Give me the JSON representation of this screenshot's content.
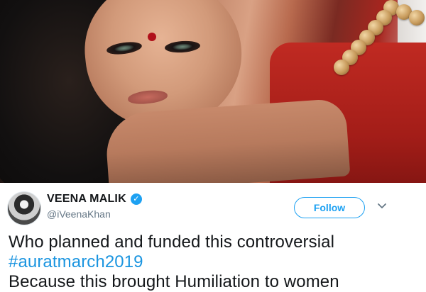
{
  "tweet": {
    "author": {
      "display_name": "VEENA MALIK",
      "handle": "@iVeenaKhan",
      "verified": true,
      "verified_icon": "verified-check-icon"
    },
    "follow_label": "Follow",
    "more_icon": "chevron-down-icon",
    "text_line1": "Who planned and funded this controversial",
    "hashtag": "#auratmarch2019",
    "text_line3_partial": "Because this brought Humiliation to women"
  },
  "colors": {
    "accent": "#1da1f2",
    "hashtag": "#1b95e0",
    "text": "#14171a",
    "muted": "#657786"
  }
}
